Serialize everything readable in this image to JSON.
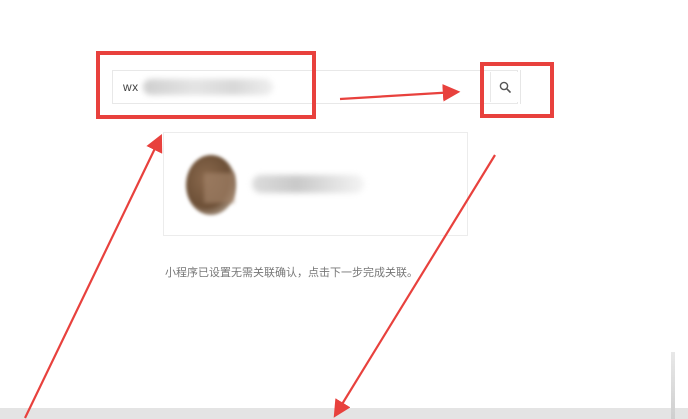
{
  "search": {
    "value": "wx",
    "button_icon": "search-icon"
  },
  "account": {
    "avatar_icon": "avatar"
  },
  "hint": {
    "text": "小程序已设置无需关联确认，点击下一步完成关联。"
  },
  "colors": {
    "annotation_red": "#e8413d",
    "border": "#e8e8e8",
    "hint_text": "#777777"
  }
}
